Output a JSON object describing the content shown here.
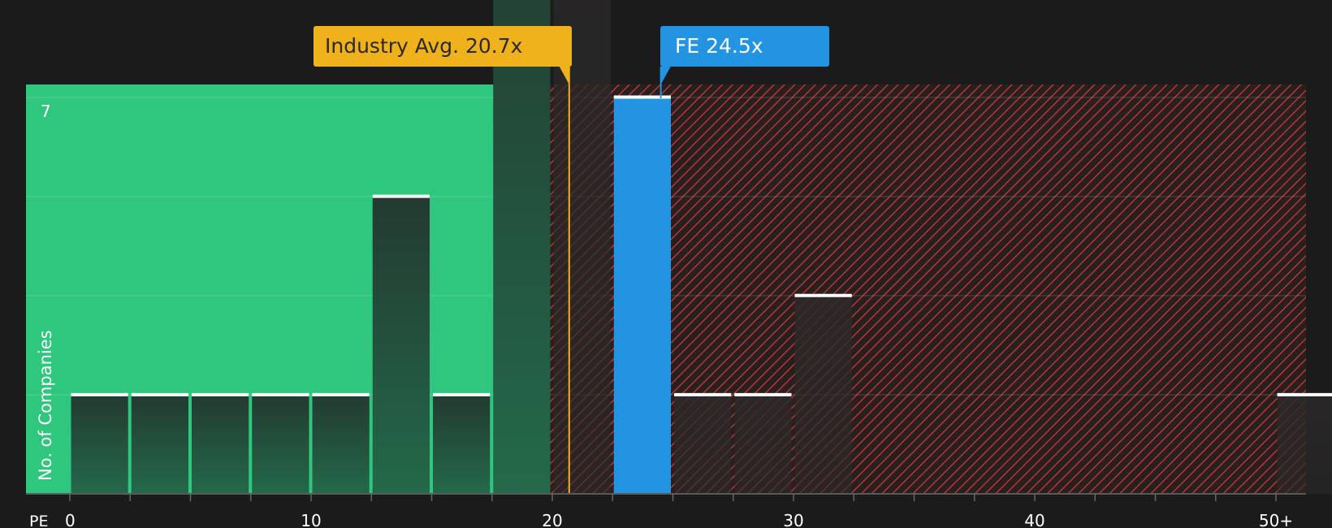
{
  "industry_label": "Industry Avg. 20.7x",
  "company_label": "FE 24.5x",
  "colors": {
    "background": "#1b1b1b",
    "undervalued_zone": "#2ec77d",
    "overvalued_stripe": "#d23c3c",
    "industry": "#efb21c",
    "company": "#2394e2",
    "bar_top": "#ffffff"
  },
  "chart_data": {
    "type": "bar",
    "xlabel": "PE",
    "ylabel": "No. of Companies",
    "ylim": [
      0,
      7
    ],
    "y_tick_labels": [
      {
        "value": 7,
        "label": "7"
      }
    ],
    "x_tick_labels": [
      {
        "value": 0,
        "label": "0"
      },
      {
        "value": 10,
        "label": "10"
      },
      {
        "value": 20,
        "label": "20"
      },
      {
        "value": 30,
        "label": "30"
      },
      {
        "value": 40,
        "label": "40"
      },
      {
        "value": 50,
        "label": "50+"
      }
    ],
    "x_range": [
      -1.8,
      51.3
    ],
    "bin_width": 2.5,
    "bins": [
      {
        "start": 0,
        "count": 1
      },
      {
        "start": 2.5,
        "count": 1
      },
      {
        "start": 5,
        "count": 1
      },
      {
        "start": 7.5,
        "count": 1
      },
      {
        "start": 10,
        "count": 1
      },
      {
        "start": 12.5,
        "count": 3
      },
      {
        "start": 15,
        "count": 1
      },
      {
        "start": 17.5,
        "count": 6
      },
      {
        "start": 20,
        "count": 7
      },
      {
        "start": 22.5,
        "count": 4,
        "highlight": true
      },
      {
        "start": 25,
        "count": 1
      },
      {
        "start": 27.5,
        "count": 1
      },
      {
        "start": 30,
        "count": 2
      },
      {
        "start": 50,
        "count": 1
      }
    ],
    "industry_avg": 20.7,
    "company_value": 24.5,
    "fair_zone_end": 20,
    "grid": true
  }
}
